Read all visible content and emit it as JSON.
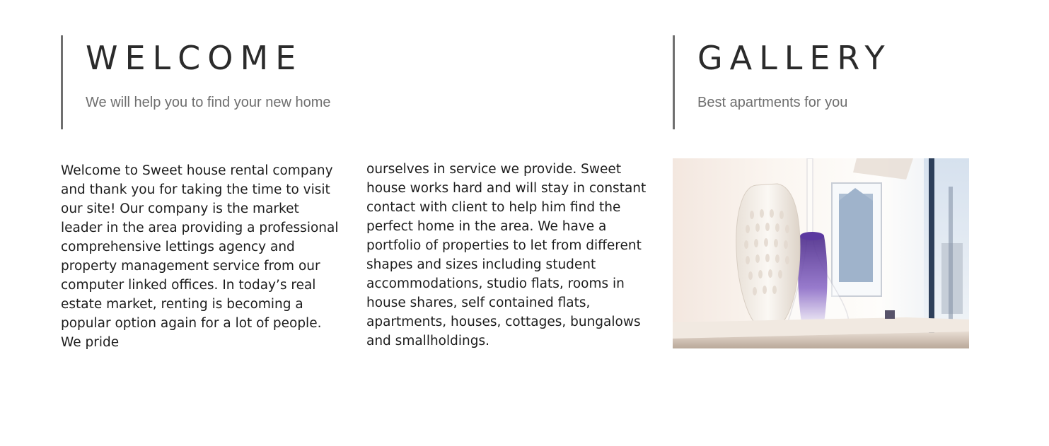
{
  "welcome": {
    "title": "WELCOME",
    "subtitle": "We will help you to find your new home",
    "paragraph_1": "Welcome to Sweet house rental company and thank you for taking the time to visit our site! Our company is the market leader in the area providing a professional comprehensive lettings agency and property management service from our computer linked offices. In today’s real estate market, renting is becoming a popular option again for a lot of people. We pride",
    "paragraph_2": "ourselves in service we provide. Sweet house works hard and will stay in constant contact with client to help him find the perfect home in the area. We have a portfolio of properties to let from different shapes and sizes including student accommodations, studio flats, rooms in house shares, self contained flats, apartments, houses, cottages, bungalows and smallholdings."
  },
  "gallery": {
    "title": "GALLERY",
    "subtitle": "Best apartments for you",
    "image_subject": "interior-vases-photo"
  },
  "colors": {
    "border_accent": "#6f6f6f",
    "subtitle_text": "#6e6e6e",
    "body_text": "#1c1c1c",
    "vase_purple": "#6b3fa8"
  }
}
